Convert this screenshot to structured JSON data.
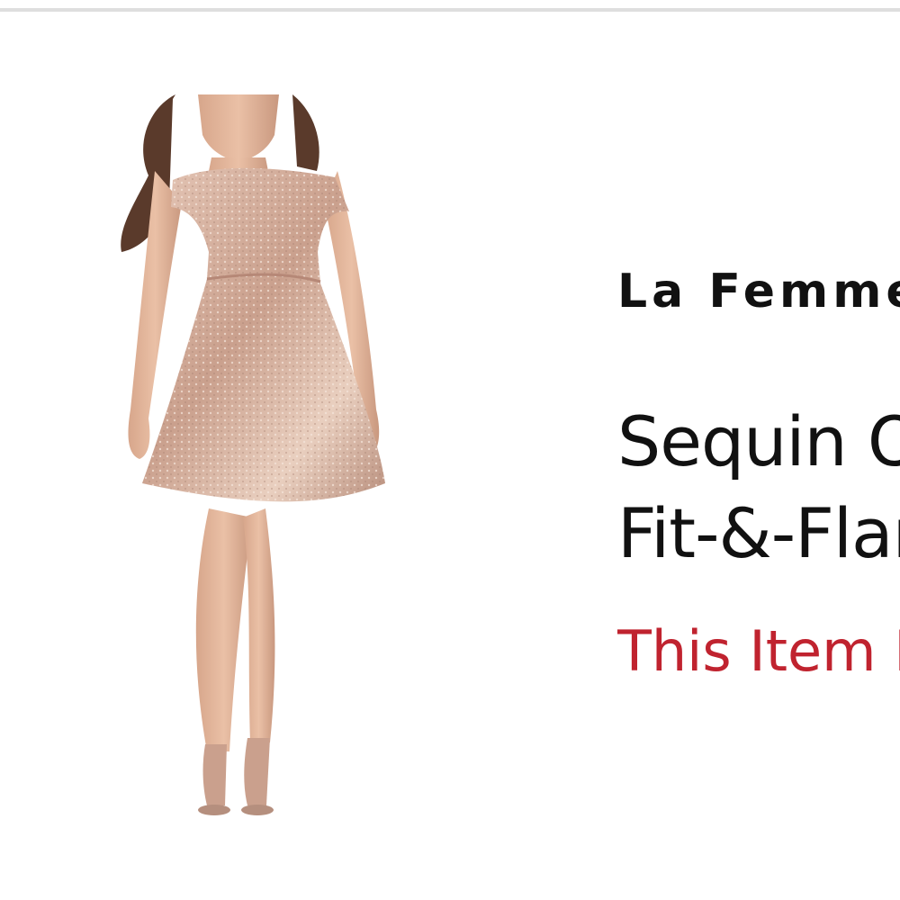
{
  "product": {
    "brand": "La Femme",
    "title_line_1": "Sequin Off-the-Shoulder",
    "title_line_2": "Fit-&-Flare Dress",
    "status": "This Item Is Unavailable",
    "image_alt": "model wearing rose gold sequin off-the-shoulder fit-and-flare dress"
  },
  "colors": {
    "status": "#c0232f",
    "dress": "#d8b19c",
    "divider": "#dedede"
  }
}
